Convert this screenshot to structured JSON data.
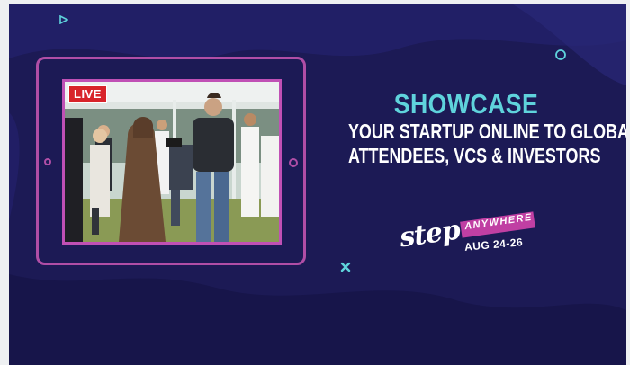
{
  "banner": {
    "live_label": "LIVE",
    "title": "SHOWCASE",
    "subtitle_line1": "YOUR STARTUP ONLINE TO GLOBAL",
    "subtitle_line2": "ATTENDEES, VCS & INVESTORS",
    "brand_name": "step",
    "brand_tag": "ANYWHERE",
    "brand_dates": "AUG 24-26"
  },
  "colors": {
    "background": "#1c1a55",
    "tablet_frame": "#b04ea6",
    "title": "#5fd3dc",
    "live_badge": "#d8242a",
    "brand_ribbon": "#c03fa3"
  },
  "icons": [
    "play-triangle-icon",
    "circle-outline-icon",
    "cross-icon",
    "camera-dot-icon"
  ]
}
